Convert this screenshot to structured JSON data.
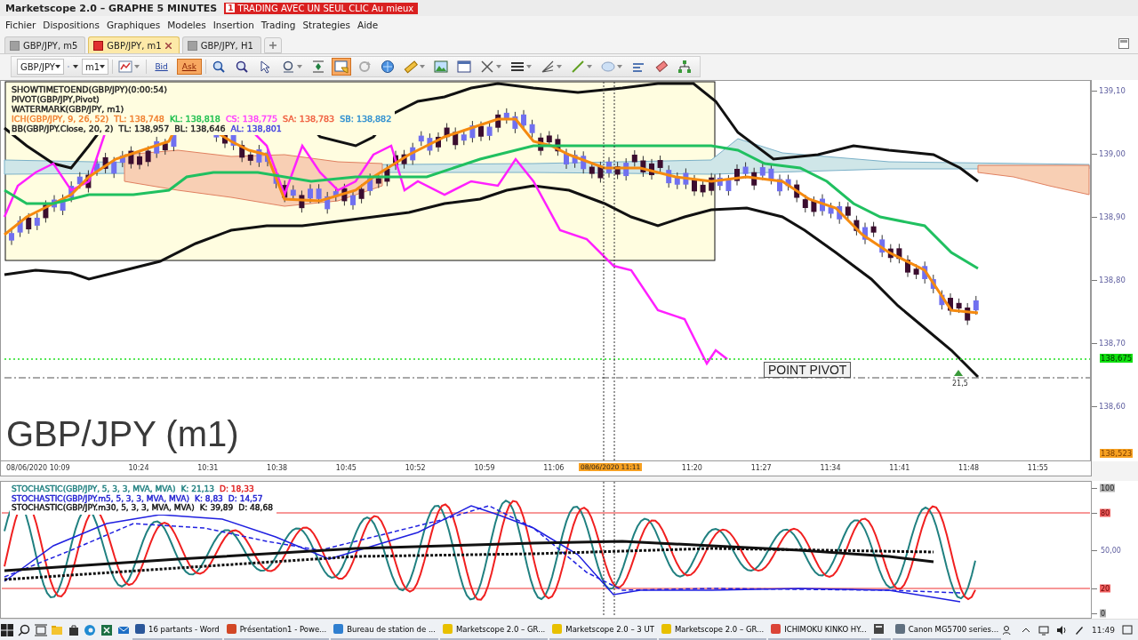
{
  "window": {
    "title": "Marketscope 2.0 – GRAPHE 5 MINUTES",
    "promo": {
      "badge": "1",
      "text": "TRADING AVEC UN SEUL CLIC Au mieux"
    }
  },
  "menu": [
    "Fichier",
    "Dispositions",
    "Graphiques",
    "Modeles",
    "Insertion",
    "Trading",
    "Strategies",
    "Aide"
  ],
  "tabs": [
    {
      "label": "GBP/JPY, m5",
      "selected": false
    },
    {
      "label": "GBP/JPY, m1",
      "selected": true
    },
    {
      "label": "GBP/JPY, H1",
      "selected": false
    }
  ],
  "toolbar": {
    "symbol": "GBP/JPY",
    "timeframe": "m1",
    "prices": [
      {
        "label": "Bid",
        "selected": false
      },
      {
        "label": "Ask",
        "selected": true
      }
    ],
    "tools": [
      {
        "kind": "dropdown",
        "selected": false
      },
      {
        "kind": "plain",
        "selected": false
      },
      {
        "kind": "plain",
        "selected": false
      },
      {
        "kind": "plain",
        "selected": false
      },
      {
        "kind": "dropdown",
        "selected": false
      },
      {
        "kind": "plain",
        "selected": false
      },
      {
        "kind": "plain",
        "selected": true
      },
      {
        "kind": "plain",
        "selected": false
      },
      {
        "kind": "plain",
        "selected": false
      },
      {
        "kind": "dropdown",
        "selected": false
      },
      {
        "kind": "plain",
        "selected": false
      },
      {
        "kind": "plain",
        "selected": false
      },
      {
        "kind": "dropdown",
        "selected": false
      },
      {
        "kind": "dropdown",
        "selected": false
      },
      {
        "kind": "dropdown",
        "selected": false
      },
      {
        "kind": "dropdown",
        "selected": false
      },
      {
        "kind": "dropdown",
        "selected": false
      },
      {
        "kind": "plain",
        "selected": false
      },
      {
        "kind": "plain",
        "selected": false
      },
      {
        "kind": "plain",
        "selected": false
      }
    ]
  },
  "chart": {
    "legend": [
      [
        {
          "text": "SHOWTIMETOEND(GBP/JPY)(0:00:54)",
          "color": "#222222"
        }
      ],
      [
        {
          "text": "PIVOT(GBP/JPY,Pivot)",
          "color": "#222222"
        }
      ],
      [
        {
          "text": "WATERMARK(GBP/JPY, m1)",
          "color": "#222222"
        }
      ],
      [
        {
          "text": "ICH(GBP/JPY, 9, 26, 52)",
          "color": "#f08030"
        },
        {
          "text": "TL: 138,748",
          "color": "#f08030"
        },
        {
          "text": "KL: 138,818",
          "color": "#20c050"
        },
        {
          "text": "CS: 138,775",
          "color": "#ff40ff"
        },
        {
          "text": "SA: 138,783",
          "color": "#f06040"
        },
        {
          "text": "SB: 138,882",
          "color": "#3090d0"
        }
      ],
      [
        {
          "text": "BB(GBP/JPY.Close, 20, 2)",
          "color": "#222222"
        },
        {
          "text": "TL: 138,957",
          "color": "#222222"
        },
        {
          "text": "BL: 138,646",
          "color": "#222222"
        },
        {
          "text": "AL: 138,801",
          "color": "#4040e0"
        }
      ]
    ],
    "watermark": "GBP/JPY (m1)",
    "pivot_label": "POINT PIVOT",
    "signal_label": "21,5",
    "price_axis": {
      "ticks": [
        "139,10",
        "139,00",
        "138,90",
        "138,80",
        "138,70",
        "138,60"
      ],
      "current_price": "138,675",
      "low_price": "138,523"
    },
    "time_axis": {
      "start": "08/06/2020 10:09",
      "labels": [
        "10:24",
        "10:31",
        "10:38",
        "10:45",
        "10:52",
        "10:59",
        "11:06",
        "11:20",
        "11:27",
        "11:34",
        "11:41",
        "11:48",
        "11:55"
      ],
      "cursor": "08/06/2020 11:11"
    }
  },
  "stochastic": {
    "legend": [
      [
        {
          "text": "STOCHASTIC(GBP/JPY, 5, 3, 3, MVA, MVA)",
          "color": "#208080"
        },
        {
          "text": "K: 21,13",
          "color": "#208080"
        },
        {
          "text": "D: 18,33",
          "color": "#e02020"
        }
      ],
      [
        {
          "text": "STOCHASTIC(GBP/JPY.m5, 5, 3, 3, MVA, MVA)",
          "color": "#2020d0"
        },
        {
          "text": "K: 8,83",
          "color": "#2020d0"
        },
        {
          "text": "D: 14,57",
          "color": "#2020d0"
        }
      ],
      [
        {
          "text": "STOCHASTIC(GBP/JPY.m30, 5, 3, 3, MVA, MVA)",
          "color": "#111111"
        },
        {
          "text": "K: 39,89",
          "color": "#111111"
        },
        {
          "text": "D: 48,68",
          "color": "#111111"
        }
      ]
    ],
    "axis": [
      {
        "label": "100",
        "kind": "bound"
      },
      {
        "label": "80",
        "kind": "limit"
      },
      {
        "label": "50,00",
        "kind": "plain"
      },
      {
        "label": "20",
        "kind": "limit"
      },
      {
        "label": "0",
        "kind": "bound"
      }
    ]
  },
  "taskbar": {
    "apps": [
      {
        "kind": "labeled",
        "label": "16 partants - Word",
        "color": "#2b579a"
      },
      {
        "kind": "labeled",
        "label": "Présentation1 - Powe...",
        "color": "#d24726"
      },
      {
        "kind": "labeled",
        "label": "Bureau de station de ...",
        "color": "#2f7fd0"
      },
      {
        "kind": "labeled",
        "label": "Marketscope 2.0 – GR...",
        "color": "#e8c000"
      },
      {
        "kind": "labeled",
        "label": "Marketscope 2.0 – 3 UT",
        "color": "#e8c000"
      },
      {
        "kind": "labeled",
        "label": "Marketscope 2.0 – GR...",
        "color": "#e8c000"
      },
      {
        "kind": "labeled",
        "label": "ICHIMOKU KINKO HY...",
        "color": "#db4437"
      },
      {
        "kind": "icon",
        "color": "#444444"
      },
      {
        "kind": "labeled",
        "label": "Canon MG5700 series...",
        "color": "#607080"
      }
    ],
    "clock": "11:49"
  }
}
